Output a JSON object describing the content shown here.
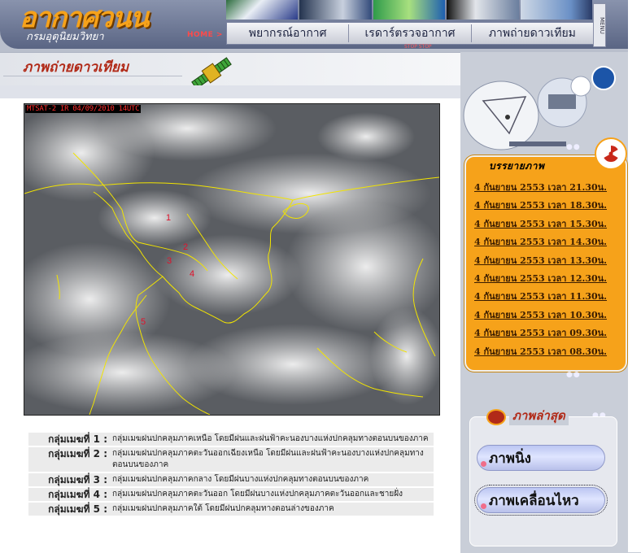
{
  "header": {
    "logo": "อากาศวนน",
    "logo_sub": "กรมอุตุนิยมวิทยา",
    "home": "HOME >",
    "nav": [
      "พยากรณ์อากาศ",
      "เรดาร์ตรวจอากาศ",
      "ภาพถ่ายดาวเทียม"
    ],
    "stop_label": "STOP STOP",
    "menu_label": "MENU"
  },
  "main": {
    "title": "ภาพถ่ายดาวเทียม",
    "image_header": "MTSAT-2 IR 04/09/2010 14UTC",
    "region_marks": [
      "1",
      "2",
      "3",
      "4",
      "5"
    ]
  },
  "legend": [
    {
      "label": "กลุ่มเมฆที่ 1 :",
      "text": "กลุ่มเมฆฝนปกคลุมภาคเหนือ โดยมีฝนและฝนฟ้าคะนองบางแห่งปกคลุมทางตอนบนของภาค"
    },
    {
      "label": "กลุ่มเมฆที่ 2 :",
      "text": "กลุ่มเมฆฝนปกคลุมภาคตะวันออกเฉียงเหนือ โดยมีฝนและฝนฟ้าคะนองบางแห่งปกคลุมทางตอนบนของภาค"
    },
    {
      "label": "กลุ่มเมฆที่ 3 :",
      "text": "กลุ่มเมฆฝนปกคลุมภาคกลาง โดยมีฝนบางแห่งปกคลุมทางตอนบนของภาค"
    },
    {
      "label": "กลุ่มเมฆที่ 4 :",
      "text": "กลุ่มเมฆฝนปกคลุมภาคตะวันออก โดยมีฝนบางแห่งปกคลุมภาคตะวันออกและชายฝั่ง"
    },
    {
      "label": "กลุ่มเมฆที่ 5 :",
      "text": "กลุ่มเมฆฝนปกคลุมภาคใต้ โดยมีฝนปกคลุมทางตอนล่างของภาค"
    }
  ],
  "sidebar": {
    "caption_title": "บรรยายภาพ",
    "captions": [
      "4 กันยายน 2553 เวลา 21.30น.",
      "4 กันยายน 2553 เวลา 18.30น.",
      "4 กันยายน 2553 เวลา 15.30น.",
      "4 กันยายน 2553 เวลา 14.30น.",
      "4 กันยายน 2553 เวลา 13.30น.",
      "4 กันยายน 2553 เวลา 12.30น.",
      "4 กันยายน 2553 เวลา 11.30น.",
      "4 กันยายน 2553 เวลา 10.30น.",
      "4 กันยายน 2553 เวลา 09.30น.",
      "4 กันยายน 2553 เวลา 08.30น."
    ],
    "latest_title": "ภาพล่าสุด",
    "btn_still": "ภาพนิ่ง",
    "btn_moving": "ภาพเคลื่อนไหว"
  },
  "colors": {
    "accent_orange": "#f6a21a",
    "title_red": "#b12a18",
    "coast_yellow": "#f2e400"
  }
}
